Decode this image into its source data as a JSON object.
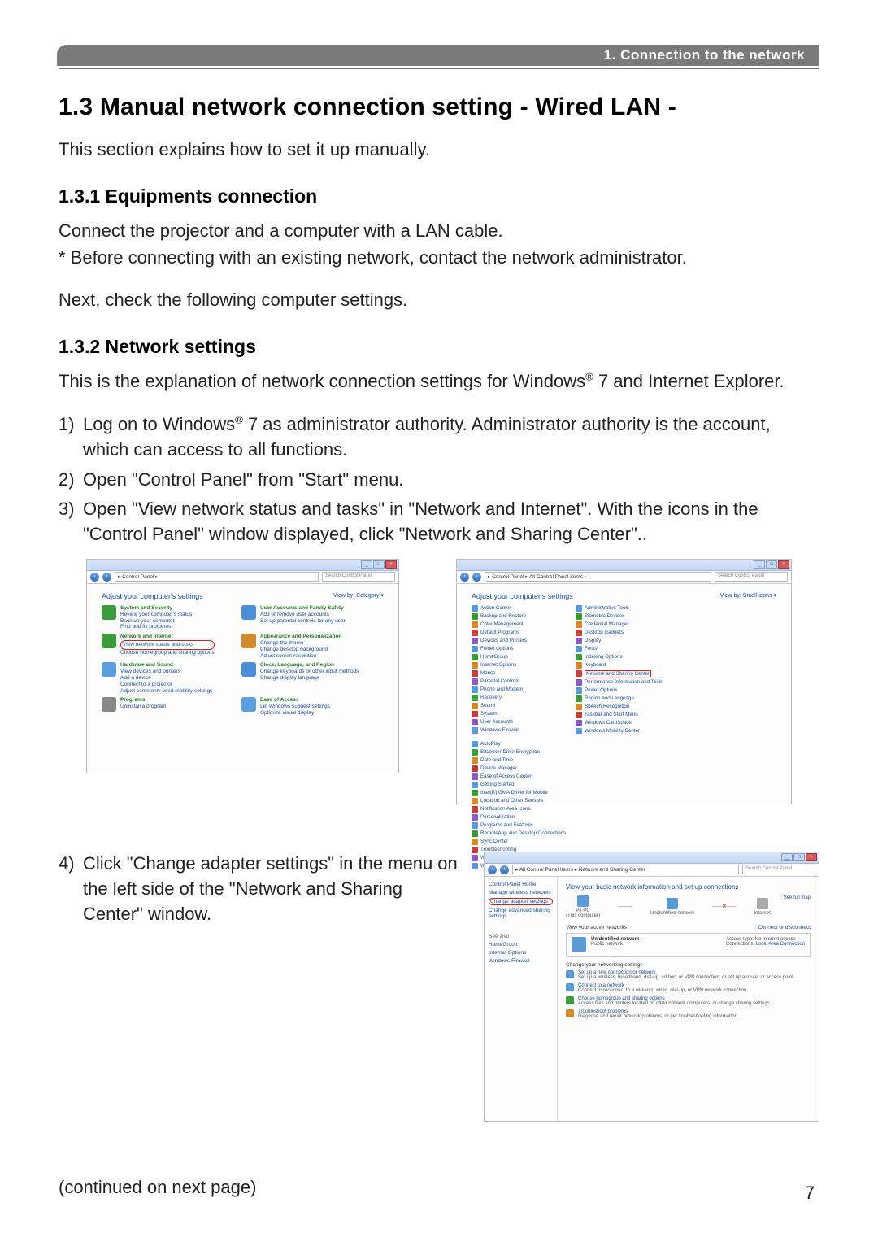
{
  "header": {
    "chapter_label": "1. Connection to the network"
  },
  "title": "1.3 Manual network connection setting - Wired LAN -",
  "intro": "This section explains how to set it up manually.",
  "subsection1": {
    "heading": "1.3.1 Equipments connection",
    "p1": "Connect the projector and a computer with a LAN cable.",
    "p2": "* Before connecting with an existing network, contact the network administrator.",
    "p3": "Next, check the following computer settings."
  },
  "subsection2": {
    "heading": "1.3.2 Network settings",
    "intro_a": "This is the explanation of network connection settings for Windows",
    "intro_b": " 7 and Internet Explorer.",
    "steps": [
      {
        "num": "1)",
        "text_a": "Log on to Windows",
        "text_b": " 7 as administrator authority. Administrator authority is the account, which can access to all functions."
      },
      {
        "num": "2)",
        "text": "Open \"Control Panel\" from \"Start\" menu."
      },
      {
        "num": "3)",
        "text": "Open \"View network status and tasks\" in \"Network and Internet\". With the icons in the \"Control Panel\" window displayed, click \"Network and Sharing Center\".."
      },
      {
        "num": "4)",
        "text": "Click \"Change adapter settings\" in the menu on the left side of the \"Network and Sharing Center\" window."
      }
    ]
  },
  "screenshot_a": {
    "breadcrumb": "▸ Control Panel ▸",
    "search_placeholder": "Search Control Panel",
    "adjust": "Adjust your computer's settings",
    "viewby": "View by:  Category ▾",
    "categories": [
      {
        "title": "System and Security",
        "links": [
          "Review your computer's status",
          "Back up your computer",
          "Find and fix problems"
        ]
      },
      {
        "title": "User Accounts and Family Safety",
        "links": [
          "Add or remove user accounts",
          "Set up parental controls for any user"
        ]
      },
      {
        "title": "Network and Internet",
        "links": [
          "View network status and tasks",
          "Choose homegroup and sharing options"
        ],
        "highlight_link": "View network status and tasks"
      },
      {
        "title": "Appearance and Personalization",
        "links": [
          "Change the theme",
          "Change desktop background",
          "Adjust screen resolution"
        ]
      },
      {
        "title": "Hardware and Sound",
        "links": [
          "View devices and printers",
          "Add a device",
          "Connect to a projector",
          "Adjust commonly used mobility settings"
        ]
      },
      {
        "title": "Clock, Language, and Region",
        "links": [
          "Change keyboards or other input methods",
          "Change display language"
        ]
      },
      {
        "title": "Programs",
        "links": [
          "Uninstall a program"
        ]
      },
      {
        "title": "Ease of Access",
        "links": [
          "Let Windows suggest settings",
          "Optimize visual display"
        ]
      }
    ]
  },
  "screenshot_b": {
    "breadcrumb": "▸ Control Panel ▸ All Control Panel Items ▸",
    "search_placeholder": "Search Control Panel",
    "adjust": "Adjust your computer's settings",
    "viewby": "View by:  Small icons ▾",
    "highlight": "Network and Sharing Center",
    "items_col1": [
      "Action Center",
      "Backup and Restore",
      "Color Management",
      "Default Programs",
      "Devices and Printers",
      "Folder Options",
      "HomeGroup",
      "Internet Options",
      "Mouse",
      "Parental Controls",
      "Phone and Modem",
      "Recovery",
      "Sound",
      "System",
      "User Accounts",
      "Windows Firewall"
    ],
    "items_col2": [
      "Administrative Tools",
      "Biometric Devices",
      "Credential Manager",
      "Desktop Gadgets",
      "Display",
      "Fonts",
      "Indexing Options",
      "Keyboard",
      "Network and Sharing Center",
      "Performance Information and Tools",
      "Power Options",
      "Region and Language",
      "Speech Recognition",
      "Taskbar and Start Menu",
      "Windows CardSpace",
      "Windows Mobility Center"
    ],
    "items_col3": [
      "AutoPlay",
      "BitLocker Drive Encryption",
      "Date and Time",
      "Device Manager",
      "Ease of Access Center",
      "Getting Started",
      "Intel(R) GMA Driver for Mobile",
      "Location and Other Sensors",
      "Notification Area Icons",
      "Personalization",
      "Programs and Features",
      "RemoteApp and Desktop Connections",
      "Sync Center",
      "Troubleshooting",
      "Windows Defender",
      "Windows Update"
    ]
  },
  "screenshot_c": {
    "breadcrumb": "▸ All Control Panel Items ▸ Network and Sharing Center",
    "search_placeholder": "Search Control Panel",
    "sidebar": {
      "home": "Control Panel Home",
      "links": [
        "Manage wireless networks",
        "Change adapter settings",
        "Change advanced sharing settings"
      ],
      "highlight": "Change adapter settings",
      "seealso": "See also",
      "seealso_links": [
        "HomeGroup",
        "Internet Options",
        "Windows Firewall"
      ]
    },
    "main": {
      "heading": "View your basic network information and set up connections",
      "see_full_map": "See full map",
      "nodes": [
        {
          "label": "PJ-PC",
          "sub": "(This computer)"
        },
        {
          "label": "Unidentified network"
        },
        {
          "label": "Internet"
        }
      ],
      "view_active": "View your active networks",
      "connect_disconnect": "Connect or disconnect",
      "network_box": {
        "name": "Unidentified network",
        "type": "Public network",
        "access_label": "Access type:",
        "access_value": "No Internet access",
        "conn_label": "Connections:",
        "conn_value": "Local Area Connection"
      },
      "change_heading": "Change your networking settings",
      "tasks": [
        {
          "title": "Set up a new connection or network",
          "desc": "Set up a wireless, broadband, dial-up, ad hoc, or VPN connection; or set up a router or access point."
        },
        {
          "title": "Connect to a network",
          "desc": "Connect or reconnect to a wireless, wired, dial-up, or VPN network connection."
        },
        {
          "title": "Choose homegroup and sharing options",
          "desc": "Access files and printers located on other network computers, or change sharing settings."
        },
        {
          "title": "Troubleshoot problems",
          "desc": "Diagnose and repair network problems, or get troubleshooting information."
        }
      ]
    }
  },
  "continued": "(continued on next page)",
  "page_num": "7",
  "registered": "®"
}
